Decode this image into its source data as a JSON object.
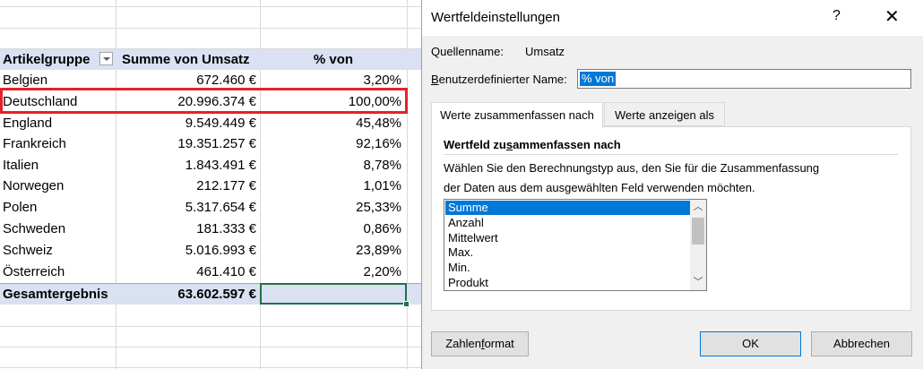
{
  "sheet": {
    "headers": {
      "col1": "Artikelgruppe",
      "col2": "Summe von Umsatz",
      "col3": "% von"
    },
    "rows": [
      {
        "name": "Belgien",
        "sum": "672.460 €",
        "pct": "3,20%"
      },
      {
        "name": "Deutschland",
        "sum": "20.996.374 €",
        "pct": "100,00%"
      },
      {
        "name": "England",
        "sum": "9.549.449 €",
        "pct": "45,48%"
      },
      {
        "name": "Frankreich",
        "sum": "19.351.257 €",
        "pct": "92,16%"
      },
      {
        "name": "Italien",
        "sum": "1.843.491 €",
        "pct": "8,78%"
      },
      {
        "name": "Norwegen",
        "sum": "212.177 €",
        "pct": "1,01%"
      },
      {
        "name": "Polen",
        "sum": "5.317.654 €",
        "pct": "25,33%"
      },
      {
        "name": "Schweden",
        "sum": "181.333 €",
        "pct": "0,86%"
      },
      {
        "name": "Schweiz",
        "sum": "5.016.993 €",
        "pct": "23,89%"
      },
      {
        "name": "Österreich",
        "sum": "461.410 €",
        "pct": "2,20%"
      }
    ],
    "total": {
      "name": "Gesamtergebnis",
      "sum": "63.602.597 €",
      "pct": ""
    },
    "highlight_color": "#e32228",
    "header_fill": "#d9e1f2",
    "selection_color": "#217346"
  },
  "dialog": {
    "title": "Wertfeldeinstellungen",
    "help_label": "?",
    "close_label": "✕",
    "source_label": "Quellenname:",
    "source_value": "Umsatz",
    "custom_name_label_pre": "",
    "custom_name_label_u": "B",
    "custom_name_label_post": "enutzerdefinierter Name:",
    "custom_name_value": "% von",
    "tabs": [
      "Werte zusammenfassen nach",
      "Werte anzeigen als"
    ],
    "section_pre": "Wertfeld zu",
    "section_u": "s",
    "section_post": "ammenfassen nach",
    "description_line1": "Wählen Sie den Berechnungstyp aus, den Sie für die Zusammenfassung",
    "description_line2": "der Daten aus dem ausgewählten Feld verwenden möchten.",
    "list_items": [
      "Summe",
      "Anzahl",
      "Mittelwert",
      "Max.",
      "Min.",
      "Produkt"
    ],
    "selected_item": "Summe",
    "number_format_pre": "Zahlen",
    "number_format_u": "f",
    "number_format_post": "ormat",
    "ok_label": "OK",
    "cancel_label": "Abbrechen",
    "accent_color": "#0078d7"
  }
}
